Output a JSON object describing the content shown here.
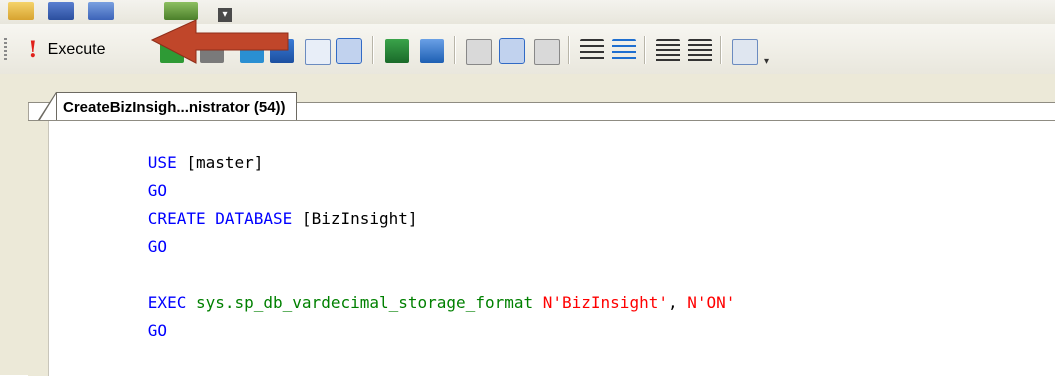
{
  "toolbar": {
    "execute_label": "Execute",
    "execute_icon": "exclamation-icon"
  },
  "tab": {
    "title": "CreateBizInsigh...nistrator (54))"
  },
  "editor": {
    "line1_kw": "USE",
    "line1_id": " [master]",
    "line2_kw": "GO",
    "line3_kw": "CREATE DATABASE",
    "line3_id": " [BizInsight]",
    "line4_kw": "GO",
    "line5_kw": "EXEC",
    "line5_sys": " sys.sp_db_vardecimal_storage_format",
    "line5_str1": " N'BizInsight'",
    "line5_sep": ",",
    "line5_str2": " N'ON'",
    "line6_kw": "GO"
  },
  "colors": {
    "keyword": "#0000ff",
    "system": "#008000",
    "string": "#ff0000",
    "arrow": "#c0462a"
  }
}
